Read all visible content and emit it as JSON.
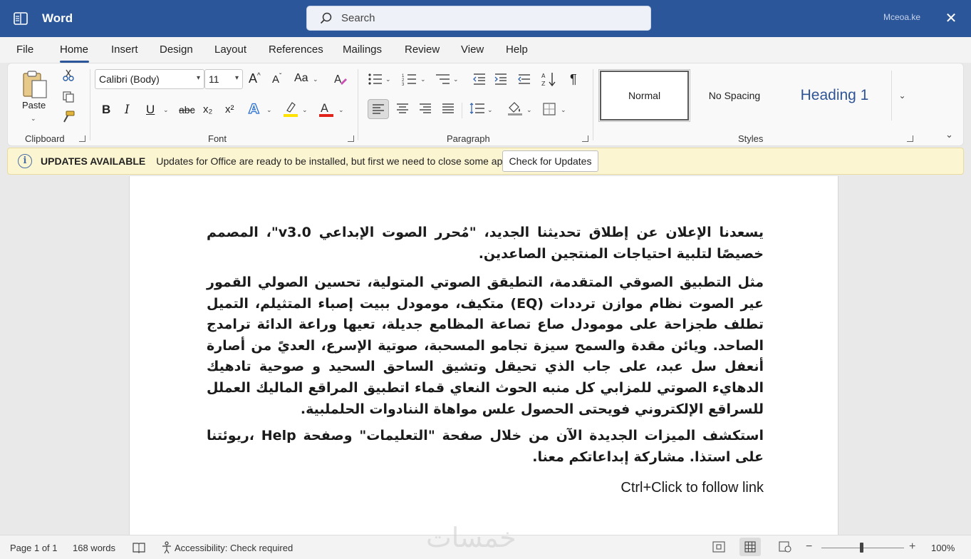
{
  "titlebar": {
    "app_name": "Word",
    "search_placeholder": "Search",
    "account": "Mceoa.ke",
    "close_glyph": "✕"
  },
  "menu": {
    "tabs": [
      "File",
      "Home",
      "Insert",
      "Design",
      "Layout",
      "References",
      "Mailings",
      "Review",
      "View",
      "Help"
    ],
    "active": "Home"
  },
  "ribbon": {
    "clipboard": {
      "label": "Clipboard",
      "paste_label": "Paste"
    },
    "font": {
      "label": "Font",
      "font_name": "Calibri (Body)",
      "font_size": "11",
      "bold": "B",
      "italic": "I",
      "underline": "U",
      "strikethrough": "abc",
      "subscript": "x₂",
      "superscript": "x²",
      "grow": "A",
      "shrink": "A",
      "case": "Aa",
      "highlight_color": "#ffe100",
      "font_color": "#e0241b"
    },
    "paragraph": {
      "label": "Paragraph"
    },
    "styles": {
      "label": "Styles",
      "items": [
        "Normal",
        "No Spacing",
        "Heading 1"
      ]
    }
  },
  "notification": {
    "title": "UPDATES AVAILABLE",
    "message": "Updates for Office are ready to be installed, but first we need to close some apps.",
    "button": "Check for Updates"
  },
  "document": {
    "paragraphs": [
      "يسعدنا الإعلان عن إطلاق تحديثنا الجديد، \"مُحرر الصوت الإبداعي v3.0\"، المصمم خصيصًا لتلبية احتياجات المنتجين الصاعدين.",
      "مثل التطبيق الصوقي المتقدمة، التطيقق الصوتي المتولية، تحسين الصولي القمور عير الصوت نظام موازن ترددات (EQ) متكيف، مومودل ببيت إصباء المتثيلم، التميل تطلف طجزاحة على مومودل صاع تصاعة المظامع جديلة، تعيها وراعة الدائة ترامدج الصاحد. ويائن مقدة والسمح سيزة تجامو المسحبة، صوتية الإسرع، العديً من أصارة أنعفل سل عبد، على جاب الذي تحيقل وتشيق الساحق السحيد و صوحية تادهيك الدهايء الصوتي للمزابي كل منبه الحوث النعاي قماء اتطبيق المراقع الماليك العملل للسراقع الإلكتروني فويحتى الحصول علس مواهاة الننادوات الحلملبية.",
      "استكشف الميزات الجديدة الآن من خلال صفحة \"التعليمات\" وصفحة Help ،ريوئتنا على استذا. مشاركة إبداعاتكم معنا."
    ],
    "link_hint": "Ctrl+Click to follow link"
  },
  "statusbar": {
    "page": "Page 1 of 1",
    "words": "168 words",
    "accessibility": "Accessibility: Check required",
    "zoom": "100%",
    "zoom_level_percent": 100
  },
  "watermark": "خمسات"
}
